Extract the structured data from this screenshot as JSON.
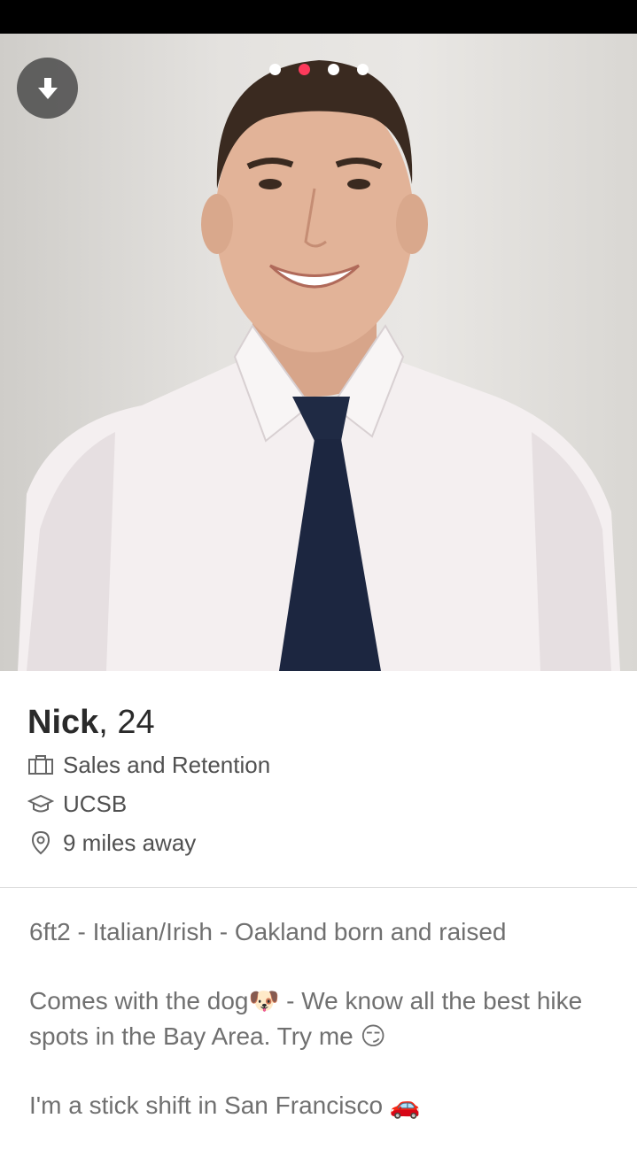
{
  "profile": {
    "name": "Nick",
    "separator": ",",
    "age": "24",
    "job": "Sales and Retention",
    "school": "UCSB",
    "distance": "9 miles away"
  },
  "photos": {
    "count": 4,
    "active_index": 1,
    "active_color": "#fd3a5b"
  },
  "icons": {
    "collapse": "arrow-down-icon",
    "job": "briefcase-icon",
    "school": "graduation-cap-icon",
    "distance": "location-pin-icon"
  },
  "bio": {
    "line1": "6ft2 - Italian/Irish - Oakland born and raised",
    "line2a": "Comes with the dog",
    "emoji_dog": "🐶",
    "line2b": " - We know all the best hike spots in the Bay Area. Try me ",
    "emoji_smirk": "😏",
    "line3": "I'm a stick shift in San Francisco ",
    "emoji_car": "🚗"
  }
}
